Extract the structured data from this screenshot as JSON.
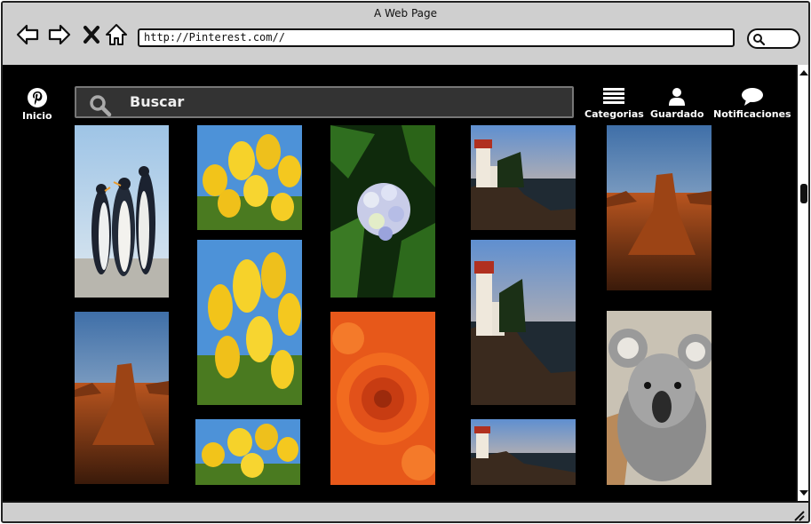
{
  "browser": {
    "title": "A Web Page",
    "url": "http://Pinterest.com//"
  },
  "app": {
    "home_label": "Inicio",
    "search_placeholder": "Buscar",
    "categories_label": "Categorias",
    "saved_label": "Guardado",
    "notifications_label": "Notificaciones"
  },
  "icons": {
    "back": "arrow-left-icon",
    "forward": "arrow-right-icon",
    "stop": "close-icon",
    "home": "home-icon",
    "search": "search-icon",
    "pinterest": "pinterest-logo-icon",
    "categories": "menu-lines-icon",
    "saved": "user-icon",
    "notifications": "speech-bubble-icon"
  },
  "pins": [
    {
      "subject": "penguins"
    },
    {
      "subject": "desert-rock"
    },
    {
      "subject": "tulips"
    },
    {
      "subject": "tulips"
    },
    {
      "subject": "tulips"
    },
    {
      "subject": "hydrangea"
    },
    {
      "subject": "orange-chrysanthemum"
    },
    {
      "subject": "lighthouse"
    },
    {
      "subject": "lighthouse"
    },
    {
      "subject": "lighthouse"
    },
    {
      "subject": "desert-rock"
    },
    {
      "subject": "koala"
    }
  ]
}
